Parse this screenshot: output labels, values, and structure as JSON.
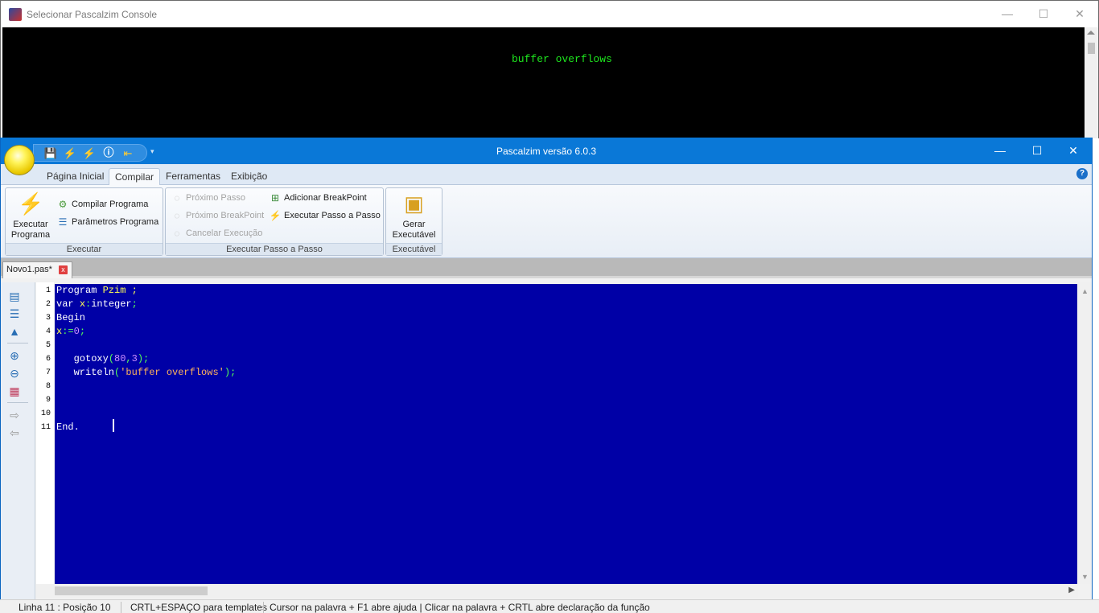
{
  "console": {
    "title": "Selecionar Pascalzim Console",
    "output": "buffer overflows",
    "minimize": "—",
    "maximize": "☐",
    "close": "✕"
  },
  "main": {
    "title": "Pascalzim versão 6.0.3",
    "minimize": "—",
    "maximize": "☐",
    "close": "✕"
  },
  "quick_access": {
    "save_icon": "save-icon",
    "run_icon": "lightning-icon",
    "step_icon": "step-icon",
    "info_icon": "info-icon",
    "exit_icon": "exit-icon",
    "more": "▾"
  },
  "ribbon_tabs": [
    {
      "label": "Página Inicial",
      "active": false
    },
    {
      "label": "Compilar",
      "active": true
    },
    {
      "label": "Ferramentas",
      "active": false
    },
    {
      "label": "Exibição",
      "active": false
    }
  ],
  "help": "?",
  "groups": {
    "executar": {
      "label": "Executar",
      "run_label_1": "Executar",
      "run_label_2": "Programa",
      "compile": "Compilar Programa",
      "params": "Parâmetros Programa"
    },
    "passo": {
      "label": "Executar Passo a Passo",
      "next_step": "Próximo Passo",
      "next_breakpoint": "Próximo BreakPoint",
      "cancel": "Cancelar Execução",
      "add_breakpoint": "Adicionar BreakPoint",
      "step_exec": "Executar Passo a Passo"
    },
    "executavel": {
      "label": "Executável",
      "gen_label_1": "Gerar",
      "gen_label_2": "Executável"
    }
  },
  "document": {
    "tab_name": "Novo1.pas*",
    "close": "x"
  },
  "editor": {
    "line_numbers": [
      "1",
      "2",
      "3",
      "4",
      "5",
      "6",
      "7",
      "8",
      "9",
      "10",
      "11"
    ],
    "lines": [
      [
        {
          "t": "Program ",
          "c": "kw"
        },
        {
          "t": "Pzim",
          "c": "id"
        },
        {
          "t": " ;",
          "c": "id"
        }
      ],
      [
        {
          "t": "var ",
          "c": "kw"
        },
        {
          "t": "x",
          "c": "id"
        },
        {
          "t": ":",
          "c": "sym"
        },
        {
          "t": "integer",
          "c": "kw"
        },
        {
          "t": ";",
          "c": "sym"
        }
      ],
      [
        {
          "t": "Begin",
          "c": "kw"
        }
      ],
      [
        {
          "t": "x",
          "c": "id"
        },
        {
          "t": ":=",
          "c": "sym"
        },
        {
          "t": "0",
          "c": "num"
        },
        {
          "t": ";",
          "c": "sym"
        }
      ],
      [],
      [
        {
          "t": "   gotoxy",
          "c": "kw"
        },
        {
          "t": "(",
          "c": "sym"
        },
        {
          "t": "80",
          "c": "num"
        },
        {
          "t": ",",
          "c": "sym"
        },
        {
          "t": "3",
          "c": "num"
        },
        {
          "t": ");",
          "c": "sym"
        }
      ],
      [
        {
          "t": "   writeln",
          "c": "kw"
        },
        {
          "t": "(",
          "c": "sym"
        },
        {
          "t": "'buffer overflows'",
          "c": "str"
        },
        {
          "t": ");",
          "c": "sym"
        }
      ],
      [],
      [],
      [],
      [
        {
          "t": "End.",
          "c": "kw"
        }
      ]
    ]
  },
  "status": {
    "position": "Linha 11 : Posição 10",
    "templates": "CRTL+ESPAÇO para templates",
    "help": "Cursor na palavra + F1 abre ajuda | Clicar na palavra + CRTL abre declaração da função"
  },
  "colors": {
    "title_bar": "#0a78d7",
    "editor_bg": "#0000a6",
    "console_text": "#1ee61e"
  }
}
